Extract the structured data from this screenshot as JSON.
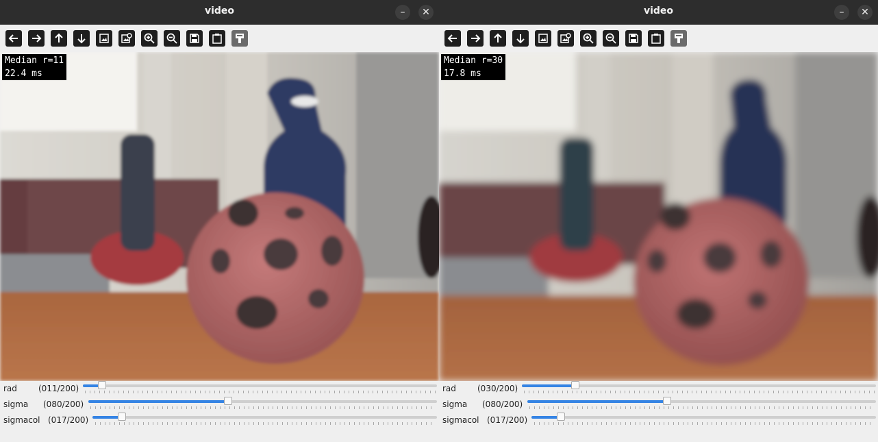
{
  "windows": [
    {
      "id": "left",
      "title": "video",
      "overlay": {
        "line1": "Median r=11",
        "line2": " 22.4 ms"
      },
      "sliders": [
        {
          "label": "rad",
          "value_text": "(011/200)",
          "value": 11,
          "max": 200
        },
        {
          "label": "sigma",
          "value_text": "(080/200)",
          "value": 80,
          "max": 200
        },
        {
          "label": "sigmacol",
          "value_text": "(017/200)",
          "value": 17,
          "max": 200
        }
      ]
    },
    {
      "id": "right",
      "title": "video",
      "overlay": {
        "line1": "Median r=30",
        "line2": " 17.8 ms"
      },
      "sliders": [
        {
          "label": "rad",
          "value_text": "(030/200)",
          "value": 30,
          "max": 200
        },
        {
          "label": "sigma",
          "value_text": "(080/200)",
          "value": 80,
          "max": 200
        },
        {
          "label": "sigmacol",
          "value_text": "(017/200)",
          "value": 17,
          "max": 200
        }
      ]
    }
  ],
  "toolbar_icons": [
    "arrow-left-icon",
    "arrow-right-icon",
    "arrow-up-icon",
    "arrow-down-icon",
    "zoom-fit-icon",
    "zoom-image-icon",
    "zoom-in-icon",
    "zoom-out-icon",
    "save-icon",
    "copy-clipboard-icon",
    "properties-icon"
  ],
  "colors": {
    "titlebar": "#2d2d2d",
    "accent": "#3584e4",
    "wall": "#c4c2bc",
    "table": "#b26c40",
    "ball": "#b56767",
    "bottle": "#2c3555"
  }
}
